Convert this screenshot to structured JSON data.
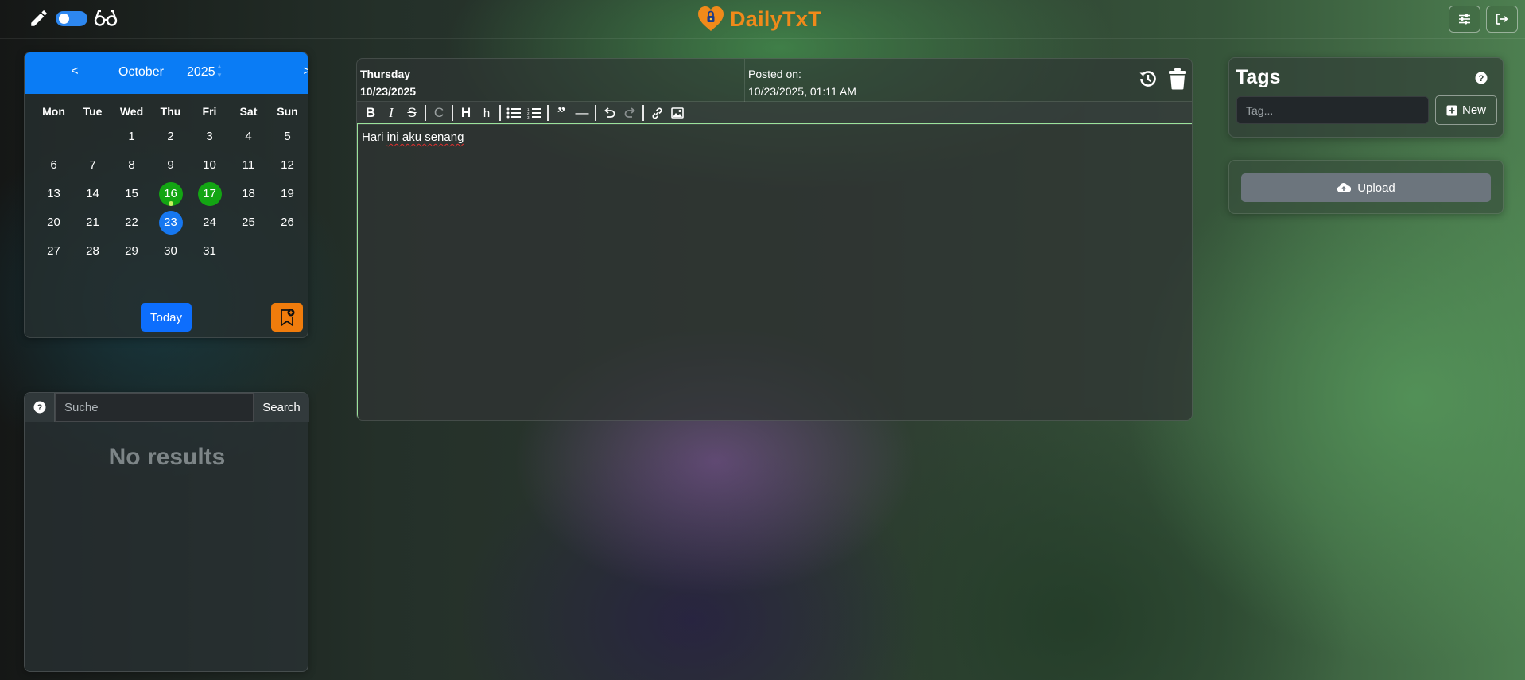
{
  "header": {
    "app_title": "DailyTxT",
    "icons": {
      "write": "pencil-icon",
      "read": "glasses-icon",
      "settings": "sliders-icon",
      "logout": "logout-icon",
      "logo": "heart-lock-icon"
    },
    "accent_color": "#f08a1a"
  },
  "calendar": {
    "prev_label": "<",
    "next_label": ">",
    "month": "October",
    "year": "2025",
    "weekdays": [
      "Mon",
      "Tue",
      "Wed",
      "Thu",
      "Fri",
      "Sat",
      "Sun"
    ],
    "weeks": [
      [
        "",
        "",
        "1",
        "2",
        "3",
        "4",
        "5"
      ],
      [
        "6",
        "7",
        "8",
        "9",
        "10",
        "11",
        "12"
      ],
      [
        "13",
        "14",
        "15",
        "16",
        "17",
        "18",
        "19"
      ],
      [
        "20",
        "21",
        "22",
        "23",
        "24",
        "25",
        "26"
      ],
      [
        "27",
        "28",
        "29",
        "30",
        "31",
        "",
        ""
      ]
    ],
    "entry_days": [
      "16",
      "17"
    ],
    "selected_day": "23",
    "dot_day": "16",
    "today_label": "Today",
    "header_color": "#0a7cf5",
    "entry_color": "#13a513",
    "selected_color": "#1677f0"
  },
  "search": {
    "placeholder": "Suche",
    "button_label": "Search",
    "empty_text": "No results"
  },
  "editor": {
    "weekday": "Thursday",
    "date": "10/23/2025",
    "posted_label": "Posted on:",
    "posted_value": "10/23/2025, 01:11 AM",
    "content": "Hari ini aku senang",
    "content_parts": [
      "Hari ",
      "ini aku senang"
    ]
  },
  "tags": {
    "title": "Tags",
    "placeholder": "Tag...",
    "new_label": "New"
  },
  "upload": {
    "button_label": "Upload",
    "button_color": "#6c757d"
  }
}
